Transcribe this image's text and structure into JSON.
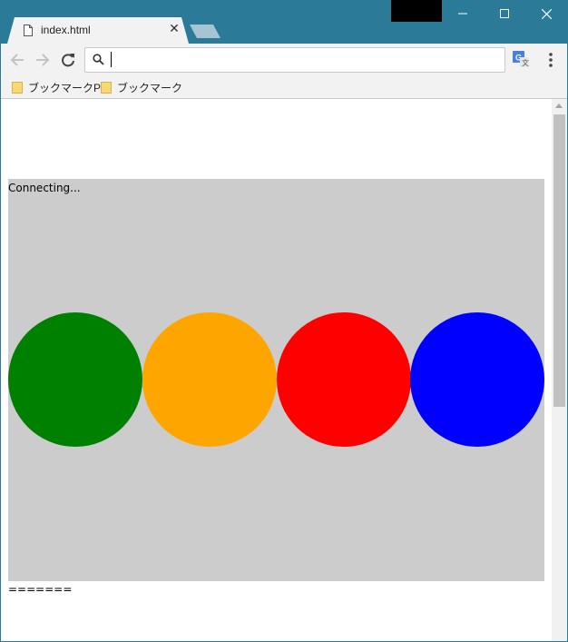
{
  "tab": {
    "title": "index.html",
    "close_glyph": "✕"
  },
  "address_bar": {
    "value": "",
    "placeholder": ""
  },
  "bookmarks": [
    {
      "label": "ブックマークPC"
    },
    {
      "label": "ブックマーク"
    }
  ],
  "page": {
    "status_text": "Connecting...",
    "footer_text": "=======",
    "stage_background": "#cccccc",
    "circles": [
      {
        "color": "#008000"
      },
      {
        "color": "#ffa500"
      },
      {
        "color": "#ff0000"
      },
      {
        "color": "#0000ff"
      }
    ]
  },
  "colors": {
    "titlebar": "#2b7a98",
    "toolbar": "#f2f2f2"
  },
  "icons": {
    "minimize": "minimize-icon",
    "maximize": "maximize-icon",
    "close": "close-icon",
    "back": "back-arrow-icon",
    "forward": "forward-arrow-icon",
    "reload": "reload-icon",
    "search": "search-icon",
    "translate": "translate-icon",
    "menu": "kebab-menu-icon",
    "folder": "folder-icon",
    "file": "file-icon"
  }
}
